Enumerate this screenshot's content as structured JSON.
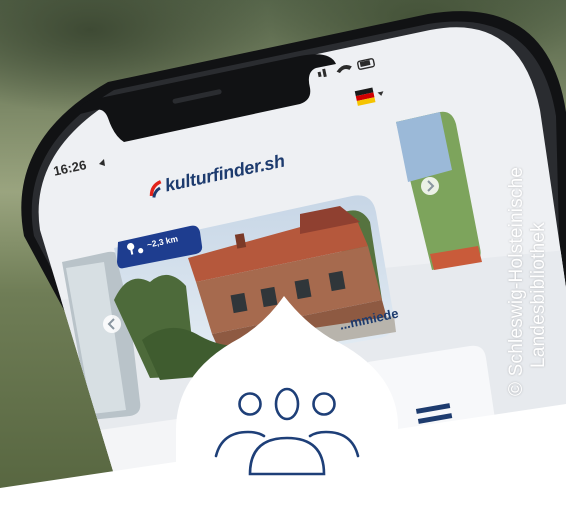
{
  "status_bar": {
    "time": "16:26"
  },
  "app": {
    "logo_text": "kulturfinder.sh"
  },
  "cards": [
    {
      "distance": "~2,3 km",
      "title": "...mmiede"
    }
  ],
  "credit": {
    "line1": "© Schleswig-Holsteinische",
    "line2": "Landesbibliothek"
  },
  "icons": [
    "flag-de-icon",
    "location-pin-icon",
    "chevron-left-icon",
    "chevron-right-icon",
    "list-icon",
    "group-people-icon"
  ],
  "colors": {
    "brand_red": "#e2231a",
    "brand_navy": "#1d3b6e",
    "icon_blue": "#1e3f78",
    "distance_badge": "#1e3d8f"
  }
}
